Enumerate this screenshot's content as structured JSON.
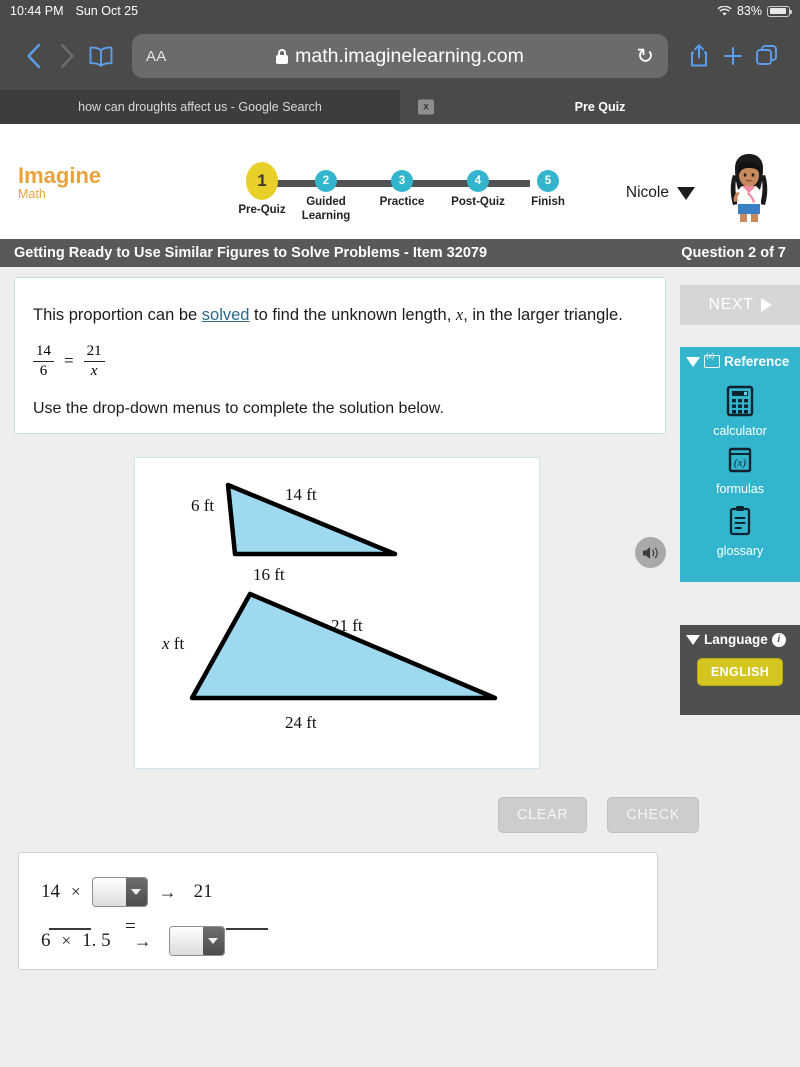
{
  "status_bar": {
    "time": "10:44 PM",
    "date": "Sun Oct 25",
    "battery_pct": "83%",
    "wifi_icon": "wifi-icon"
  },
  "browser": {
    "back_icon": "chevron-left-icon",
    "forward_icon": "chevron-right-icon",
    "bookmarks_icon": "book-icon",
    "text_size_label": "AA",
    "lock_icon": "lock-icon",
    "url": "math.imaginelearning.com",
    "reload_icon": "reload-icon",
    "share_icon": "share-icon",
    "new_tab_icon": "plus-icon",
    "tabs_icon": "tabs-overview-icon",
    "tabs": [
      {
        "title": "how can droughts affect us - Google Search",
        "active": false,
        "close_label": "x"
      },
      {
        "title": "Pre Quiz",
        "active": true
      }
    ]
  },
  "app_header": {
    "logo_line1": "Imagine",
    "logo_line2": "Math",
    "user_name": "Nicole",
    "user_caret_icon": "chevron-down-icon",
    "avatar_icon": "student-avatar",
    "progress_steps": [
      {
        "number": "1",
        "label": "Pre-Quiz",
        "state": "current"
      },
      {
        "number": "2",
        "label": "Guided\nLearning",
        "state": "upcoming"
      },
      {
        "number": "3",
        "label": "Practice",
        "state": "upcoming"
      },
      {
        "number": "4",
        "label": "Post-Quiz",
        "state": "upcoming"
      },
      {
        "number": "5",
        "label": "Finish",
        "state": "upcoming"
      }
    ]
  },
  "title_bar": {
    "lesson_title": "Getting Ready to Use Similar Figures to Solve Problems - Item 32079",
    "question_counter": "Question 2 of 7"
  },
  "question": {
    "prompt_part1": "This proportion can be ",
    "prompt_link": "solved",
    "prompt_part2": " to find the unknown length, ",
    "prompt_var": "x",
    "prompt_part3": ", in the larger triangle.",
    "proportion": {
      "left_num": "14",
      "left_den": "6",
      "equals": "=",
      "right_num": "21",
      "right_den": "x"
    },
    "instruction": "Use the drop-down menus to complete the solution below.",
    "speaker_icon": "speaker-icon"
  },
  "diagram": {
    "fill_color": "#9fd9f0",
    "stroke_color": "#000000",
    "small_triangle": {
      "side_label": "6 ft",
      "hyp_label": "14 ft",
      "base_label": "16 ft"
    },
    "large_triangle": {
      "side_label": "x ft",
      "hyp_label": "21 ft",
      "base_label": "24 ft"
    }
  },
  "buttons": {
    "clear": "CLEAR",
    "check": "CHECK"
  },
  "answer": {
    "top_left_number": "14",
    "top_times": "×",
    "top_dropdown_value": "",
    "top_arrow": "→",
    "top_result": "21",
    "equals": "=",
    "bottom_left_number": "6",
    "bottom_times": "×",
    "bottom_factor": "1. 5",
    "bottom_arrow": "→",
    "bottom_dropdown_value": "",
    "dropdown_caret_icon": "chevron-down-icon"
  },
  "rail": {
    "next_label": "NEXT",
    "next_arrow_icon": "play-triangle-icon",
    "reference_header": "Reference",
    "reference_collapse_icon": "triangle-down-icon",
    "tools": [
      {
        "label": "calculator",
        "icon": "calculator-icon"
      },
      {
        "label": "formulas",
        "icon": "formulas-icon"
      },
      {
        "label": "glossary",
        "icon": "clipboard-icon"
      }
    ],
    "language_header": "Language",
    "language_collapse_icon": "triangle-down-icon",
    "language_info_icon": "info-icon",
    "language_value": "ENGLISH"
  },
  "colors": {
    "accent_teal": "#33b5ce",
    "accent_yellow": "#e8d028",
    "brand_orange": "#e8a33d",
    "title_gray": "#58595b",
    "lang_button": "#d4c520"
  }
}
